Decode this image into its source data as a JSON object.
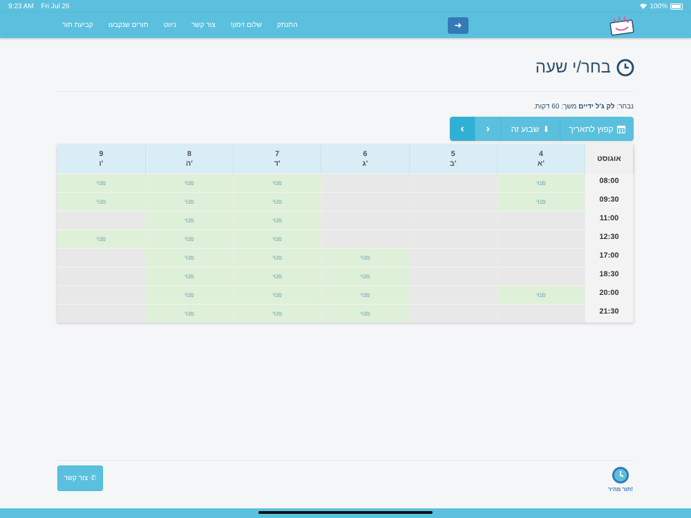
{
  "status": {
    "time": "9:23 AM",
    "date": "Fri Jul 26",
    "battery": "100%"
  },
  "nav": {
    "links": [
      "קביעת תור",
      "תורים שנקבעו",
      "ניווט",
      "צור קשר",
      "שלום זימון!",
      "התנתק"
    ]
  },
  "page": {
    "title": "בחר/י שעה",
    "chosen_prefix": "נבחר:",
    "service": "לק ג'ל ידיים",
    "duration_text": "משך: 60 דקות."
  },
  "toolbar": {
    "jump_label": "קפוץ לתאריך",
    "week_label": "שבוע זה"
  },
  "calendar": {
    "month": "אוגוסט",
    "days": [
      {
        "num": "4",
        "name": "א'"
      },
      {
        "num": "5",
        "name": "ב'"
      },
      {
        "num": "6",
        "name": "ג'"
      },
      {
        "num": "7",
        "name": "ד'"
      },
      {
        "num": "8",
        "name": "ה'"
      },
      {
        "num": "9",
        "name": "ו'"
      }
    ],
    "free_label": "פנוי",
    "rows": [
      {
        "time": "08:00",
        "slots": [
          true,
          false,
          false,
          true,
          true,
          true
        ]
      },
      {
        "time": "09:30",
        "slots": [
          true,
          false,
          false,
          true,
          true,
          true
        ]
      },
      {
        "time": "11:00",
        "slots": [
          false,
          false,
          false,
          true,
          true,
          false
        ]
      },
      {
        "time": "12:30",
        "slots": [
          false,
          false,
          false,
          true,
          true,
          true
        ]
      },
      {
        "time": "17:00",
        "slots": [
          false,
          false,
          true,
          true,
          true,
          false
        ]
      },
      {
        "time": "18:30",
        "slots": [
          false,
          false,
          true,
          true,
          true,
          false
        ]
      },
      {
        "time": "20:00",
        "slots": [
          true,
          false,
          true,
          true,
          true,
          false
        ]
      },
      {
        "time": "21:30",
        "slots": [
          false,
          false,
          true,
          true,
          true,
          false
        ]
      }
    ]
  },
  "footer": {
    "contact_label": "צור קשר",
    "brand_text": "תור מהיר!"
  }
}
